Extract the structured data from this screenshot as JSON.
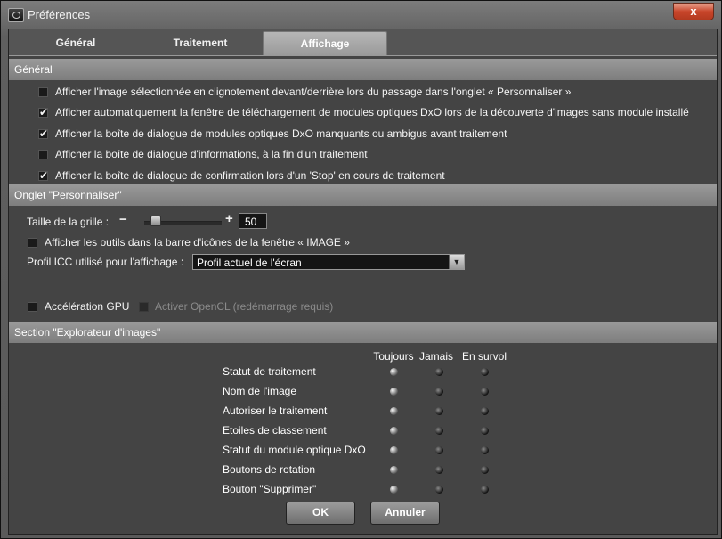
{
  "window": {
    "title": "Préférences",
    "close_glyph": "x"
  },
  "tabs": [
    {
      "label": "Général"
    },
    {
      "label": "Traitement"
    },
    {
      "label": "Affichage"
    }
  ],
  "sections": {
    "general": {
      "title": "Général",
      "options": [
        {
          "label": "Afficher l'image sélectionnée en clignotement devant/derrière lors du passage dans l'onglet « Personnaliser »",
          "checked": false
        },
        {
          "label": "Afficher automatiquement la fenêtre de téléchargement de modules optiques DxO lors de la découverte d'images sans module installé",
          "checked": true
        },
        {
          "label": "Afficher la boîte de dialogue de modules optiques DxO manquants ou ambigus avant traitement",
          "checked": true
        },
        {
          "label": "Afficher la boîte de dialogue d'informations, à la fin d'un traitement",
          "checked": false
        },
        {
          "label": "Afficher la boîte de dialogue de confirmation lors d'un 'Stop' en cours de traitement",
          "checked": true
        }
      ]
    },
    "personnaliser": {
      "title": "Onglet \"Personnaliser\"",
      "grid_label": "Taille de la grille :",
      "minus": "−",
      "plus": "+",
      "grid_value": "50",
      "grid_slider_fraction": 0.15,
      "tools_option": {
        "label": "Afficher les outils dans la barre d'icônes de la fenêtre « IMAGE »",
        "checked": false
      },
      "icc_label": "Profil ICC utilisé pour l'affichage :",
      "icc_value": "Profil actuel de l'écran",
      "gpu": {
        "label": "Accélération GPU",
        "checked": false
      },
      "opencl": {
        "label": "Activer OpenCL (redémarrage requis)",
        "checked": false,
        "disabled": true
      }
    },
    "explorer": {
      "title": "Section \"Explorateur d'images\"",
      "columns": [
        "Toujours",
        "Jamais",
        "En survol"
      ],
      "rows": [
        {
          "label": "Statut de traitement",
          "selected": 0
        },
        {
          "label": "Nom de l'image",
          "selected": 0
        },
        {
          "label": "Autoriser le traitement",
          "selected": 0
        },
        {
          "label": "Etoiles de classement",
          "selected": 0
        },
        {
          "label": "Statut du module optique DxO",
          "selected": 0
        },
        {
          "label": "Boutons de rotation",
          "selected": 0
        },
        {
          "label": "Bouton \"Supprimer\"",
          "selected": 0
        }
      ]
    }
  },
  "buttons": {
    "ok": "OK",
    "cancel": "Annuler"
  }
}
